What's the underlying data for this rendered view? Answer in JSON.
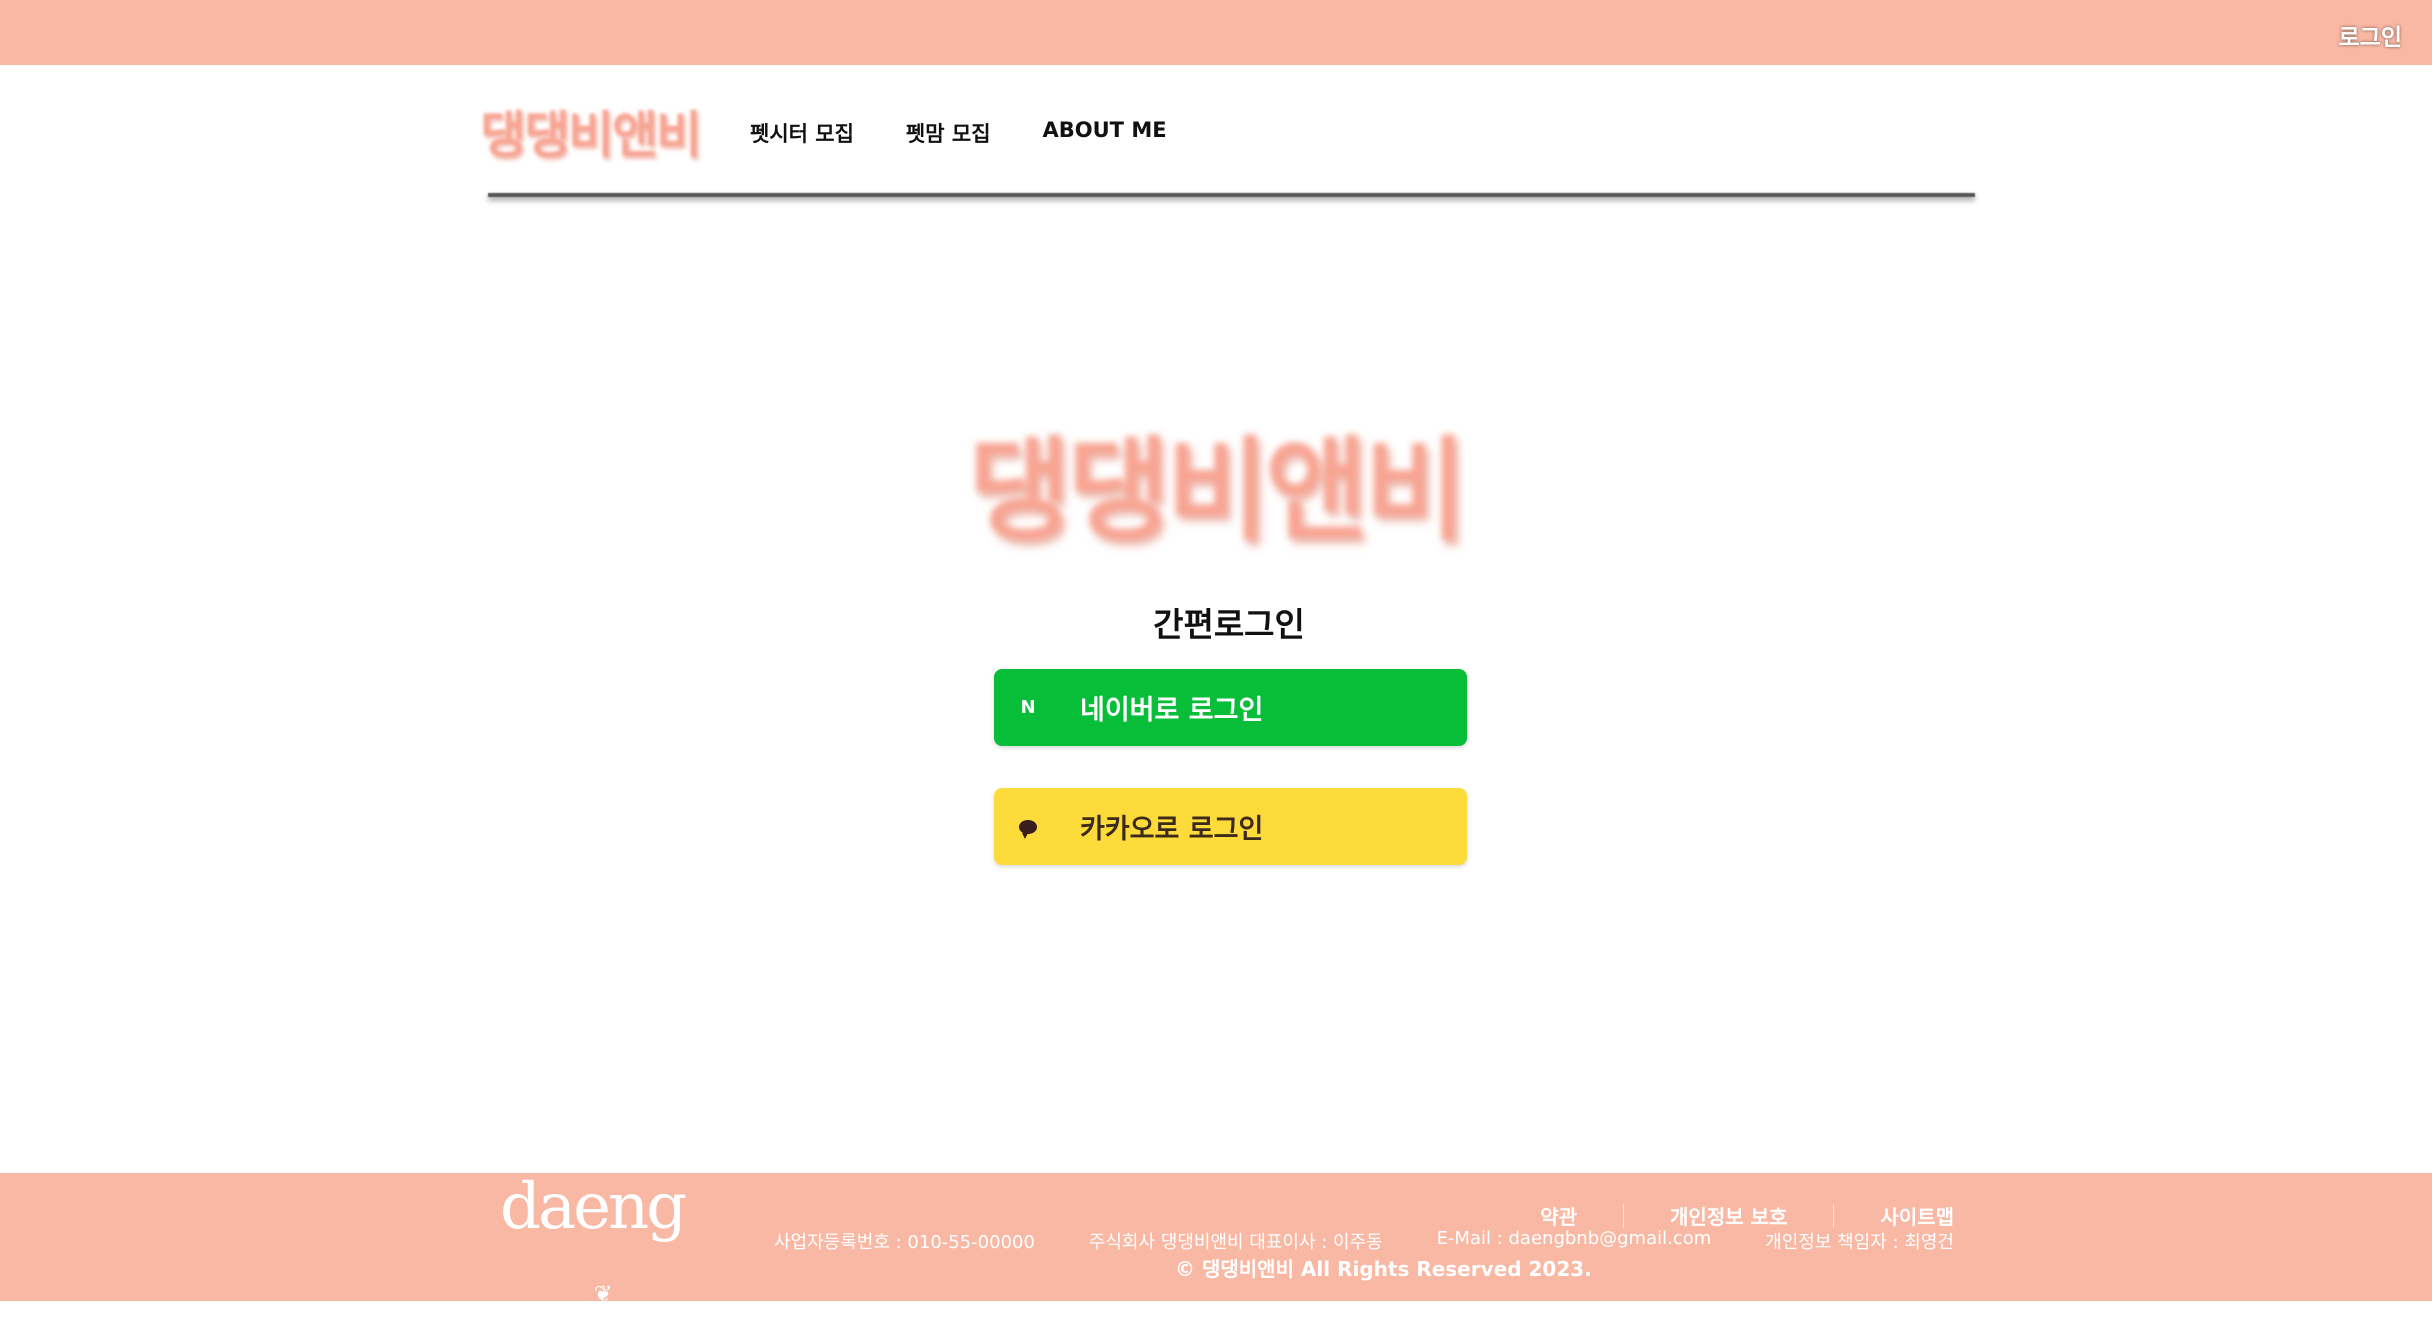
{
  "topbar": {
    "login_label": "로그인"
  },
  "header": {
    "logo_text": "댕댕비앤비",
    "nav": [
      {
        "label": "펫시터 모집"
      },
      {
        "label": "펫맘 모집"
      },
      {
        "label": "ABOUT ME"
      }
    ]
  },
  "main": {
    "logo_text": "댕댕비앤비",
    "title": "간편로그인",
    "naver": {
      "icon": "naver-n-icon",
      "icon_glyph": "N",
      "label": "네이버로 로그인",
      "color": "#08be39"
    },
    "kakao": {
      "icon": "kakao-bubble-icon",
      "label": "카카오로 로그인",
      "color": "#fcdb3a"
    }
  },
  "footer": {
    "logo_text": "daeng",
    "links": [
      {
        "label": "약관"
      },
      {
        "label": "개인정보 보호"
      },
      {
        "label": "사이트맵"
      }
    ],
    "info": {
      "business_no": "사업자등록번호 : 010-55-00000",
      "company": "주식회사 댕댕비앤비 대표이사 : 이주동",
      "email": "E-Mail : daengbnb@gmail.com",
      "privacy_officer": "개인정보 책임자 : 최영건"
    },
    "copyright": "© 댕댕비앤비 All Rights Reserved 2023."
  },
  "colors": {
    "brand_peach": "#f9b8a4",
    "logo_pink": "#f8a492",
    "naver_green": "#08be39",
    "kakao_yellow": "#fcdb3a"
  }
}
